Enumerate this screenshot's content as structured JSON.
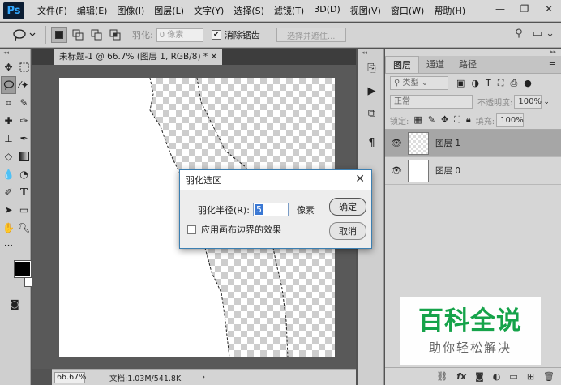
{
  "app": {
    "logo": "Ps",
    "menu": [
      "文件(F)",
      "编辑(E)",
      "图像(I)",
      "图层(L)",
      "文字(Y)",
      "选择(S)",
      "滤镜(T)",
      "3D(D)",
      "视图(V)",
      "窗口(W)",
      "帮助(H)"
    ],
    "window_controls": {
      "minimize": "—",
      "restore": "❐",
      "close": "✕"
    }
  },
  "options_bar": {
    "feather_label": "羽化:",
    "feather_value": "0 像素",
    "antialias_label": "消除锯齿",
    "antialias_checked": true,
    "select_mask_button": "选择并遮住..."
  },
  "document": {
    "tab_title": "未标题-1 @ 66.7% (图层 1, RGB/8) *",
    "zoom": "66.67%",
    "doc_info": "文档:1.03M/541.8K"
  },
  "layers_panel": {
    "tabs": [
      "图层",
      "通道",
      "路径"
    ],
    "active_tab": "图层",
    "filter_kind": "类型",
    "blend_mode": "正常",
    "opacity_label": "不透明度:",
    "opacity_value": "100%",
    "lock_label": "锁定:",
    "fill_label": "填充:",
    "fill_value": "100%",
    "layers": [
      {
        "name": "图层 1",
        "selected": true
      },
      {
        "name": "图层 0",
        "selected": false
      }
    ],
    "bottom_icons": [
      "link-icon",
      "fx-icon",
      "mask-icon",
      "adjustment-icon",
      "folder-icon",
      "new-layer-icon",
      "trash-icon"
    ]
  },
  "dialog": {
    "title": "羽化选区",
    "radius_label": "羽化半径(R):",
    "radius_value": "5",
    "unit": "像素",
    "checkbox_label": "应用画布边界的效果",
    "checkbox_checked": false,
    "ok_button": "确定",
    "cancel_button": "取消"
  },
  "watermark": {
    "main": "百科全说",
    "sub": "助你轻松解决"
  },
  "colors": {
    "accent": "#31a8ff",
    "watermark_green": "#16a34a",
    "dialog_border": "#3c7fb1"
  }
}
